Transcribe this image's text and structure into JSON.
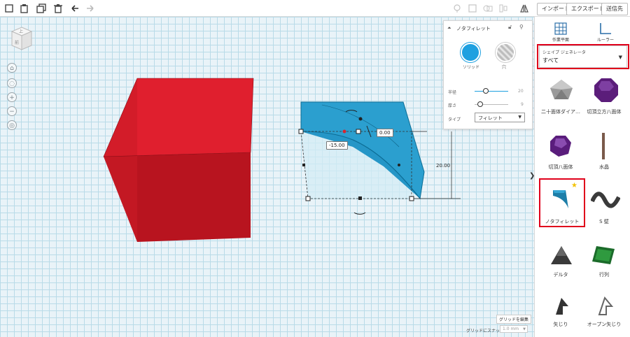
{
  "toolbar": {
    "import_label": "インポート",
    "export_label": "エクスポート",
    "send_label": "送信先"
  },
  "viewcube": {
    "top": "上",
    "front": "前"
  },
  "inspector": {
    "title": "ノタフィレット",
    "solid_label": "ソリッド",
    "hole_label": "穴",
    "radius_label": "半径",
    "radius_value": "20",
    "thickness_label": "厚さ",
    "thickness_value": "9",
    "type_label": "タイプ",
    "type_value": "フィレット"
  },
  "dimensions": {
    "width": "-15.00",
    "offset": "0.00",
    "height": "20.00"
  },
  "library": {
    "workplane_label": "作業平面",
    "ruler_label": "ルーラー",
    "category_label": "シェイプ ジェネレータ",
    "category_value": "すべて",
    "shapes": [
      {
        "label": "二十面体ダイア…"
      },
      {
        "label": "切頂立方八面体"
      },
      {
        "label": "切頂八面体"
      },
      {
        "label": "水晶"
      },
      {
        "label": "ノタフィレット"
      },
      {
        "label": "S 壁"
      },
      {
        "label": "デルタ"
      },
      {
        "label": "行列"
      },
      {
        "label": "矢じり"
      },
      {
        "label": "オープン矢じり"
      }
    ]
  },
  "bottom": {
    "grid_edit_label": "グリッドを編集",
    "snap_label": "グリッドにスナップ",
    "snap_value": "1.0 mm"
  },
  "colors": {
    "box": "#d81e2c",
    "fillet": "#1f93c6",
    "highlight": "#e0001b",
    "accent": "#1ea0e0"
  }
}
